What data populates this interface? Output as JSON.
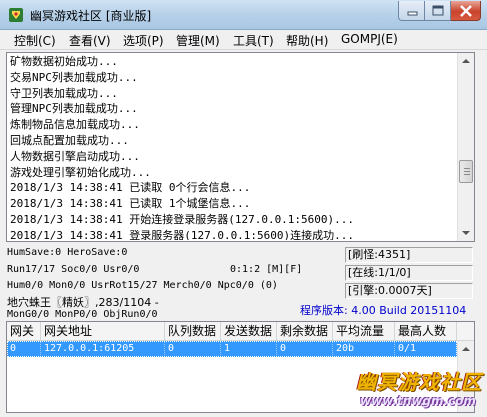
{
  "window": {
    "title": "幽冥游戏社区 [商业版]"
  },
  "menu": {
    "items": [
      {
        "label": "控制(C)"
      },
      {
        "label": "查看(V)"
      },
      {
        "label": "选项(P)"
      },
      {
        "label": "管理(M)"
      },
      {
        "label": "工具(T)"
      },
      {
        "label": "帮助(H)"
      },
      {
        "label": "GOMPJ(E)"
      }
    ]
  },
  "log": {
    "lines": [
      "矿物数据初始成功...",
      "交易NPC列表加载成功...",
      "守卫列表加载成功...",
      "管理NPC列表加载成功...",
      "炼制物品信息加载成功...",
      "回城点配置加载成功...",
      "人物数据引擎启动成功...",
      "游戏处理引擎初始化成功...",
      "2018/1/3 14:38:41 已读取 0个行会信息...",
      "2018/1/3 14:38:41 已读取 1个城堡信息...",
      "2018/1/3 14:38:41 开始连接登录服务器(127.0.0.1:5600)...",
      "2018/1/3 14:38:41 登录服务器(127.0.0.1:5600)连接成功..."
    ]
  },
  "status": {
    "humsave": "HumSave:0 HeroSave:0",
    "run": "Run17/17 Soc0/0 Usr0/0",
    "clock": "0:1:2 [M][F]",
    "hum": "Hum0/0 Mon0/0 UsrRot15/27 Merch0/0 Npc0/0 (0)",
    "map": "地穴蛛王〖精妖〗,283/1104 -",
    "mong": "MonG0/0 MonP0/0 ObjRun0/0",
    "refresh": "[刷怪:4351]",
    "online": "[在线:1/1/0]",
    "loop": "[引擎:0.0007天]",
    "version": "程序版本: 4.00 Build 20151104"
  },
  "table": {
    "headers": [
      "网关",
      "网关地址",
      "队列数据",
      "发送数据",
      "剩余数据",
      "平均流量",
      "最高人数"
    ],
    "rows": [
      [
        "0",
        "127.0.0.1:61205",
        "0",
        "1",
        "0",
        "20b",
        "0/1"
      ]
    ]
  },
  "watermark": {
    "title": "幽冥游戏社区",
    "url": "www.tnwgm.com"
  },
  "colors": {
    "selection": "#3399ff",
    "version_text": "#0000cc",
    "watermark_gold": "#f0b400"
  }
}
